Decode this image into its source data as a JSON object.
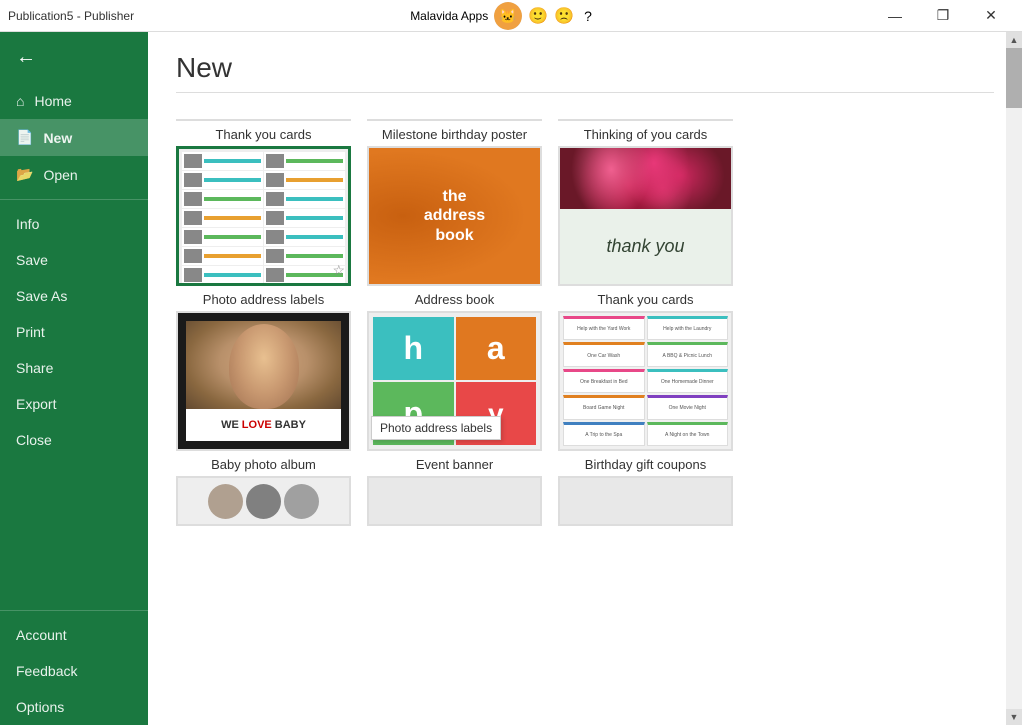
{
  "titlebar": {
    "app_title": "Publication5  -  Publisher",
    "center_app": "Malavida Apps",
    "btn_minimize": "—",
    "btn_restore": "❐",
    "btn_close": "✕"
  },
  "sidebar": {
    "back_label": "",
    "items": [
      {
        "id": "home",
        "label": "Home",
        "icon": "home-icon",
        "active": false
      },
      {
        "id": "new",
        "label": "New",
        "icon": "new-icon",
        "active": true
      },
      {
        "id": "open",
        "label": "Open",
        "icon": "open-icon",
        "active": false
      }
    ],
    "divider1": true,
    "info_items": [
      {
        "id": "info",
        "label": "Info"
      },
      {
        "id": "save",
        "label": "Save"
      },
      {
        "id": "save-as",
        "label": "Save As"
      },
      {
        "id": "print",
        "label": "Print"
      },
      {
        "id": "share",
        "label": "Share"
      },
      {
        "id": "export",
        "label": "Export"
      },
      {
        "id": "close",
        "label": "Close"
      }
    ],
    "divider2": true,
    "bottom_items": [
      {
        "id": "account",
        "label": "Account"
      },
      {
        "id": "feedback",
        "label": "Feedback"
      },
      {
        "id": "options",
        "label": "Options"
      }
    ]
  },
  "main": {
    "title": "New",
    "tooltip_text": "Photo address labels",
    "template_rows": [
      {
        "templates": [
          {
            "id": "thank-you-cards-top",
            "label": "Thank you cards"
          },
          {
            "id": "milestone-birthday-poster",
            "label": "Milestone birthday poster"
          },
          {
            "id": "thinking-of-you-cards",
            "label": "Thinking of you cards"
          }
        ]
      },
      {
        "templates": [
          {
            "id": "photo-address-labels",
            "label": "Photo address labels",
            "selected": true,
            "has_pin": true
          },
          {
            "id": "address-book",
            "label": "Address book"
          },
          {
            "id": "thank-you-cards-flower",
            "label": "Thank you cards"
          }
        ]
      },
      {
        "templates": [
          {
            "id": "baby-photo-album",
            "label": "Baby photo album"
          },
          {
            "id": "event-banner",
            "label": "Event banner"
          },
          {
            "id": "birthday-gift-coupons",
            "label": "Birthday gift coupons"
          }
        ]
      },
      {
        "templates": [
          {
            "id": "partial-bottom-1",
            "label": ""
          },
          {
            "id": "partial-bottom-2",
            "label": ""
          },
          {
            "id": "partial-bottom-3",
            "label": ""
          }
        ]
      }
    ]
  }
}
